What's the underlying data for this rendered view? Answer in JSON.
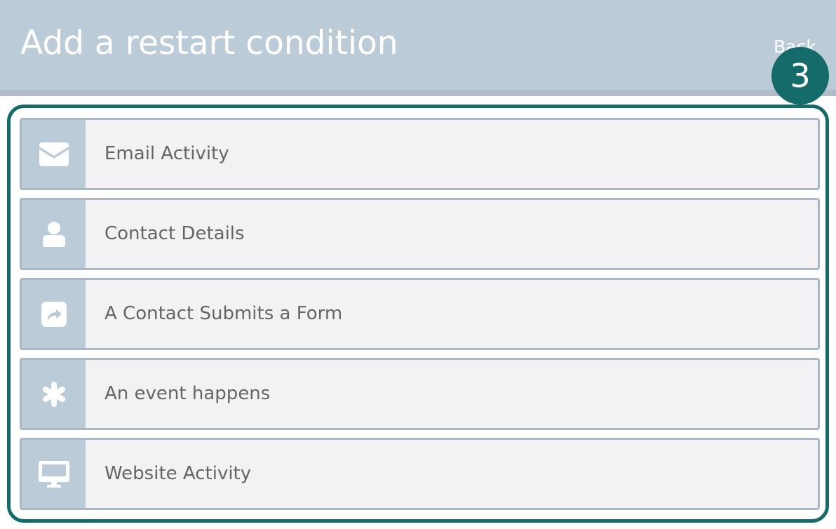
{
  "header": {
    "title": "Add a restart condition",
    "back_label": "Back"
  },
  "step_badge": "3",
  "conditions": [
    {
      "label": "Email Activity",
      "icon": "envelope-icon"
    },
    {
      "label": "Contact Details",
      "icon": "user-icon"
    },
    {
      "label": "A Contact Submits a Form",
      "icon": "share-square-icon"
    },
    {
      "label": "An event happens",
      "icon": "asterisk-icon"
    },
    {
      "label": "Website Activity",
      "icon": "desktop-icon"
    }
  ],
  "colors": {
    "header_bg": "#bccbd8",
    "accent": "#146b6a",
    "row_bg": "#f2f2f4",
    "row_border": "#abb7c3",
    "label_text": "#656565"
  }
}
